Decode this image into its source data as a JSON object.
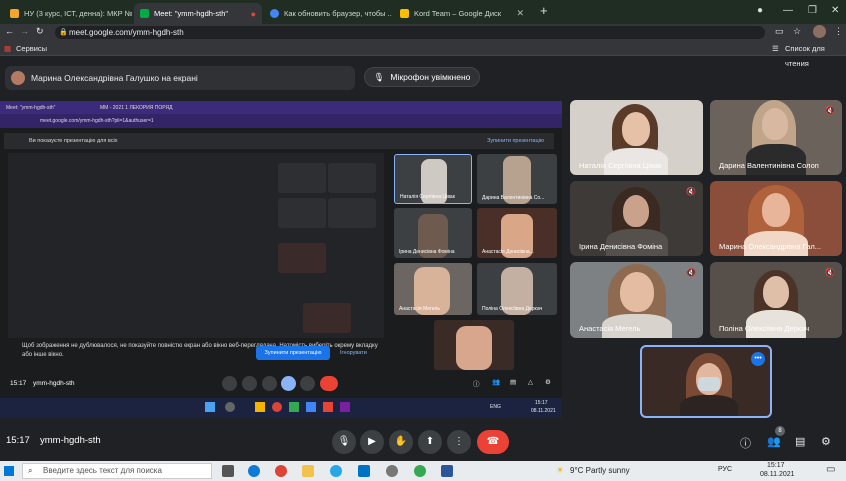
{
  "browser": {
    "tabs": [
      {
        "label": "НУ (3 курс, ІСТ, денна): МКР №",
        "favicon_color": "#f4a62a",
        "active": false
      },
      {
        "label": "Meet: \"ymm-hgdh-sth\"",
        "favicon_color": "#00ac47",
        "active": true
      },
      {
        "label": "Как обновить браузер, чтобы ...",
        "favicon_color": "#4285f4",
        "active": false
      },
      {
        "label": "Kord Team – Google Диск",
        "favicon_color": "#fbbc04",
        "active": false
      }
    ],
    "new_tab": "+",
    "url": "meet.google.com/ymm-hgdh-sth",
    "bookmarks": {
      "services": "Сервисы",
      "reading_list": "Список для чтения"
    }
  },
  "meet": {
    "presenter_label": "Марина Олександрівна Галушко на екрані",
    "mic_status": "Мікрофон увімкнено",
    "time": "15:17",
    "meeting_code": "ymm-hgdh-sth",
    "participants_count": "8",
    "shared_screen": {
      "tabs": [
        "Meet: \"ymm-hgdh-sth\"",
        "MM - 2021 1 ЛЕКОРИЯ ПОРЯД"
      ],
      "url": "meet.google.com/ymm-hgdh-sth?pli=1&authuser=1",
      "notice": "Ви показуєте презентацію для всіх",
      "stop_link": "Зупинити презентацію",
      "warning": "Щоб зображення не дублювалося, не показуйте повністю екран або вікно веб-переглядача. Натомість виберіть окрему вкладку або інше вікно.",
      "stop_button": "Зупинити презентацію",
      "ignore": "Ігнорувати",
      "time": "15:17",
      "code": "ymm-hgdh-sth",
      "lang": "ENG",
      "tray_time": "15:17",
      "tray_date": "08.11.2021",
      "mini_tiles": [
        {
          "name": "Наталія Сергіївна Цівак"
        },
        {
          "name": "Дарина Валентинівна Со..."
        },
        {
          "name": "Ірина Денисівна Фоміна"
        },
        {
          "name": "Анастасія Денисівна..."
        },
        {
          "name": "Анастасія Мегель"
        },
        {
          "name": "Поліна Олексіївна Деркач"
        }
      ]
    },
    "participants": [
      {
        "name": "Наталія Сергіївна Цівак",
        "muted": false
      },
      {
        "name": "Дарина Валентинівна Солоп",
        "muted": true
      },
      {
        "name": "Ірина Денисівна Фоміна",
        "muted": true
      },
      {
        "name": "Марина Олександрівна Гал...",
        "muted": false
      },
      {
        "name": "Анастасія Мегель",
        "muted": true
      },
      {
        "name": "Поліна Олексіївна Деркач",
        "muted": true
      },
      {
        "name": "",
        "muted": false
      }
    ]
  },
  "windows": {
    "search_placeholder": "Введите здесь текст для поиска",
    "weather": "9°C  Partly sunny",
    "lang": "РУС",
    "time": "15:17",
    "date": "08.11.2021"
  },
  "colors": {
    "accent": "#8ab4f8",
    "end_call": "#ea4335",
    "share_blue": "#1a73e8"
  }
}
